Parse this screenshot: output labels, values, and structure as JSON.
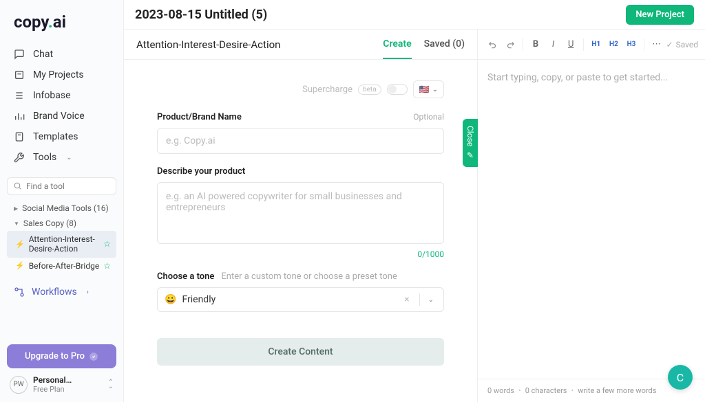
{
  "logo": {
    "text1": "copy",
    "dot": ".",
    "text2": "ai"
  },
  "sidebar": {
    "nav": {
      "chat": "Chat",
      "projects": "My Projects",
      "infobase": "Infobase",
      "brandvoice": "Brand Voice",
      "templates": "Templates",
      "tools": "Tools"
    },
    "search_placeholder": "Find a tool",
    "groups": {
      "social": {
        "label": "Social Media Tools (16)"
      },
      "sales": {
        "label": "Sales Copy (8)"
      }
    },
    "subitems": {
      "aida": "Attention-Interest-Desire-Action",
      "bab": "Before-After-Bridge"
    },
    "workflows": "Workflows",
    "upgrade": "Upgrade to Pro",
    "user": {
      "initials": "PW",
      "name": "Personal…",
      "plan": "Free Plan"
    }
  },
  "topbar": {
    "title": "2023-08-15 Untitled (5)",
    "new_project": "New Project"
  },
  "form": {
    "template_name": "Attention-Interest-Desire-Action",
    "tabs": {
      "create": "Create",
      "saved": "Saved (0)"
    },
    "supercharge": "Supercharge",
    "beta": "beta",
    "flag": "🇺🇸",
    "product_label": "Product/Brand Name",
    "optional": "Optional",
    "product_placeholder": "e.g. Copy.ai",
    "describe_label": "Describe your product",
    "describe_placeholder": "e.g. an AI powered copywriter for small businesses and entrepreneurs",
    "char_count": "0/1000",
    "tone_label": "Choose a tone",
    "tone_hint": "Enter a custom tone or choose a preset tone",
    "tone_emoji": "😀",
    "tone_value": "Friendly",
    "create_btn": "Create Content",
    "close": "Close"
  },
  "editor": {
    "saved": "Saved",
    "placeholder": "Start typing, copy, or paste to get started...",
    "h1": "H1",
    "h2": "H2",
    "h3": "H3",
    "footer": {
      "words": "0 words",
      "chars": "0 characters",
      "more": "write a few more words"
    }
  }
}
